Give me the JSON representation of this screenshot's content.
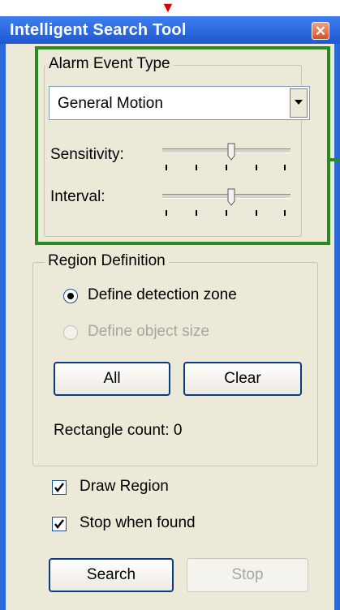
{
  "window": {
    "title": "Intelligent Search Tool",
    "close_glyph": "✕"
  },
  "alarm_event_type": {
    "legend": "Alarm Event Type",
    "combo_value": "General Motion",
    "sensitivity_label": "Sensitivity:",
    "sensitivity_level": 0.5,
    "interval_label": "Interval:",
    "interval_level": 0.5
  },
  "region_definition": {
    "legend": "Region Definition",
    "radio_zone_label": "Define detection zone",
    "radio_zone_selected": true,
    "radio_size_label": "Define object size",
    "radio_size_enabled": false,
    "all_label": "All",
    "clear_label": "Clear",
    "rect_count_text": "Rectangle count: 0"
  },
  "options": {
    "draw_region_label": "Draw Region",
    "draw_region_checked": true,
    "stop_when_found_label": "Stop when found",
    "stop_when_found_checked": true
  },
  "actions": {
    "search_label": "Search",
    "stop_label": "Stop",
    "stop_enabled": false
  },
  "colors": {
    "title_bar": "#2a6ad8",
    "highlight": "#2b8a22",
    "arrow": "#e00000",
    "panel": "#ece9d8"
  }
}
